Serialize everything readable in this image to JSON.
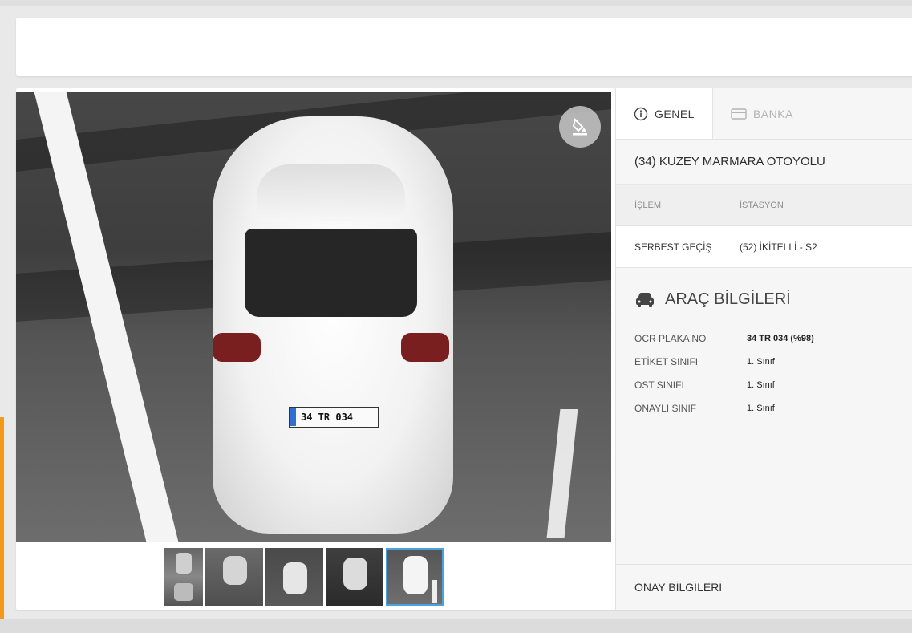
{
  "tabs": [
    {
      "label": "GENEL",
      "icon": "info-icon",
      "active": true
    },
    {
      "label": "BANKA",
      "icon": "card-icon",
      "active": false
    }
  ],
  "highway_title": "(34) KUZEY MARMARA OTOYOLU",
  "transaction_table": {
    "headers": [
      "İŞLEM",
      "İSTASYON"
    ],
    "rows": [
      [
        "SERBEST GEÇİŞ",
        "(52) İKİTELLİ - S2"
      ]
    ]
  },
  "vehicle_section": {
    "title": "ARAÇ BİLGİLERİ",
    "icon": "car-icon",
    "fields": [
      {
        "label": "OCR PLAKA NO",
        "value": "34 TR 034 (%98)"
      },
      {
        "label": "ETİKET SINIFI",
        "value": "1. Sınıf"
      },
      {
        "label": "OST SINIFI",
        "value": "1. Sınıf"
      },
      {
        "label": "ONAYLI SINIF",
        "value": "1. Sınıf"
      }
    ]
  },
  "approval_section_title": "ONAY BİLGİLERİ",
  "camera": {
    "plate_text": "34 TR 034",
    "action_icon": "paint-bucket-icon"
  },
  "thumbnails": [
    {
      "label": "thumbnail-1",
      "selected": false
    },
    {
      "label": "thumbnail-2",
      "selected": false
    },
    {
      "label": "thumbnail-3",
      "selected": false
    },
    {
      "label": "thumbnail-4",
      "selected": false
    },
    {
      "label": "thumbnail-5",
      "selected": true
    }
  ],
  "colors": {
    "accent": "#f39a1b",
    "selection": "#4aa3df"
  }
}
